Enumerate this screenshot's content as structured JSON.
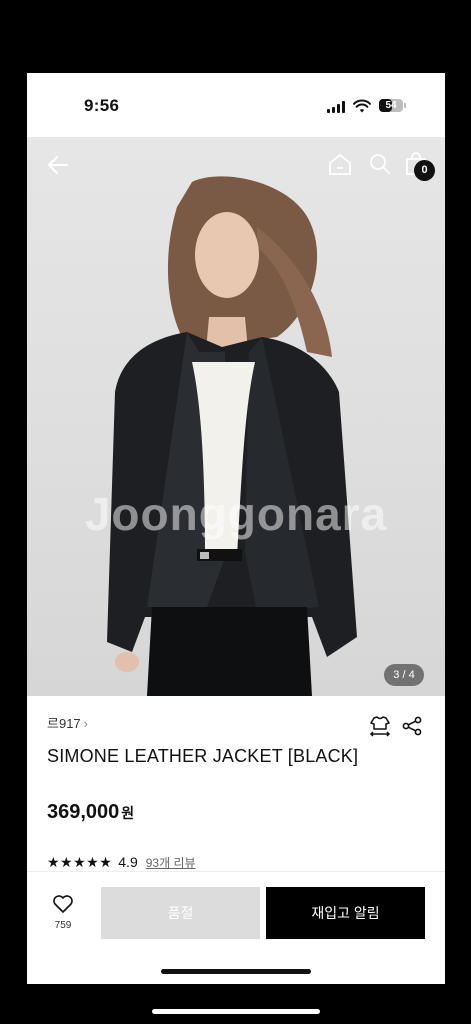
{
  "status_bar": {
    "time": "9:56",
    "battery": "54",
    "battery_level": 0.54
  },
  "nav": {
    "back_icon": "back-arrow-icon",
    "home_icon": "home-icon",
    "search_icon": "search-icon",
    "cart_icon": "shopping-bag-icon",
    "cart_count": "0"
  },
  "photo": {
    "watermark": "Joonggonara",
    "page_indicator": "3 / 4"
  },
  "product": {
    "brand": "르917",
    "brand_chevron": "›",
    "title": "SIMONE LEATHER JACKET [BLACK]",
    "price": "369,000",
    "currency": "원",
    "stars": "★★★★★",
    "rating": "4.9",
    "review_link": "93개 리뷰"
  },
  "actions": {
    "hanger_icon": "hanger-size-icon",
    "share_icon": "share-icon"
  },
  "bottom_bar": {
    "wish_icon": "heart-icon",
    "wish_count": "759",
    "soldout_label": "품절",
    "restock_label": "재입고 알림"
  },
  "colors": {
    "accent": "#000000",
    "disabled": "#dcdcdc"
  }
}
